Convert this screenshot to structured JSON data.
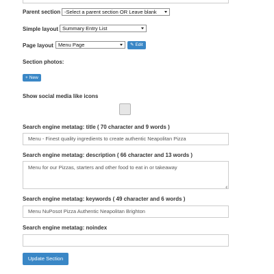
{
  "parent_section": {
    "label": "Parent section",
    "value": "-Select a parent section OR Leave blank"
  },
  "simple_layout": {
    "label": "Simple layout",
    "value": "Summary Entry List"
  },
  "page_layout": {
    "label": "Page layout",
    "value": "Menu Page",
    "edit_label": "Edit",
    "edit_icon": "edit-icon"
  },
  "section_photos": {
    "label": "Section photos:",
    "new_label": "New",
    "new_icon": "plus-icon"
  },
  "social": {
    "label": "Show social media like icons"
  },
  "meta_title": {
    "label": "Search engine metatag: title ( 70 character and 9 words )",
    "value": "Menu - Finest quality ingredients to create authentic Neapolitan Pizza"
  },
  "meta_description": {
    "label": "Search engine metatag: description ( 66 character and 13 words )",
    "value": "Menu for our Pizzas, starters and other food to eat in or takeaway"
  },
  "meta_keywords": {
    "label": "Search engine metatag: keywords ( 49 character and 6 words )",
    "value": "Menu NuPosot Pizza Authentic Neapolitan Brighton"
  },
  "meta_noindex": {
    "label": "Search engine metatag: noindex",
    "value": ""
  },
  "update_button": {
    "label": "Update Section"
  },
  "colors": {
    "accent": "#3a87c6",
    "border": "#cccccc"
  }
}
